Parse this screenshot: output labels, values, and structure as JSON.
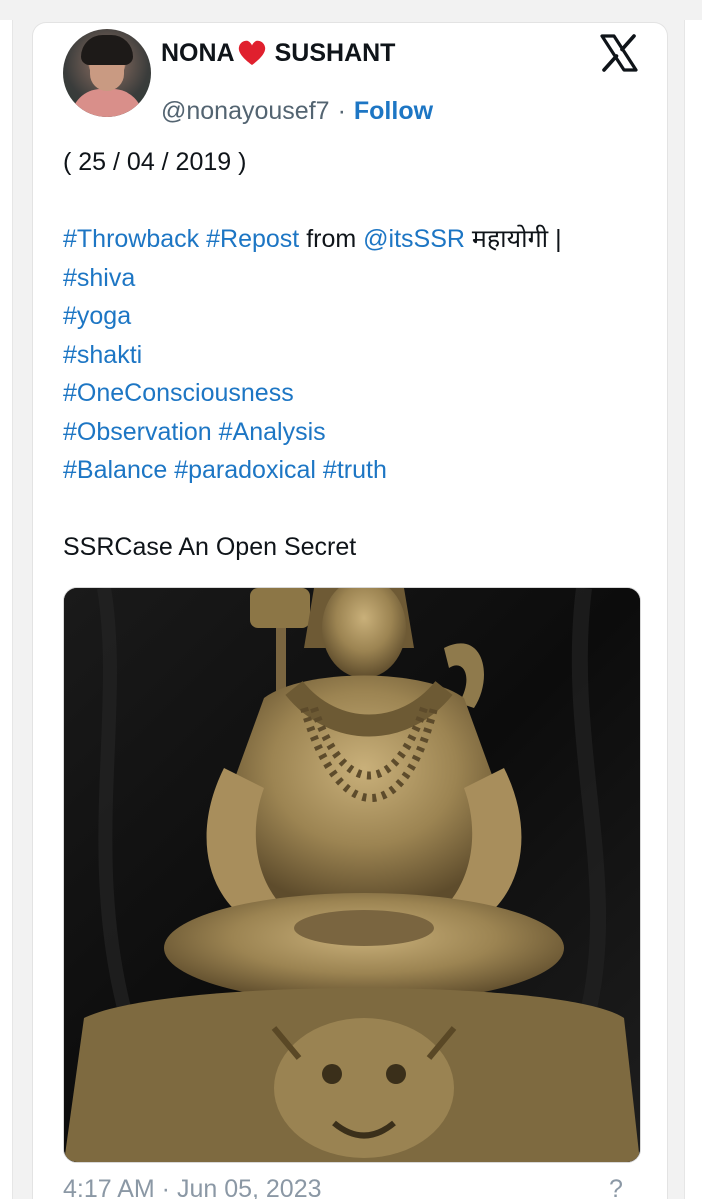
{
  "tweet": {
    "author_name_part1": "NONA",
    "author_name_part2": "SUSHANT",
    "handle": "@nonayousef7",
    "separator": "·",
    "follow_label": "Follow",
    "date_line": "( 25 / 04 / 2019 )",
    "line1": {
      "tag1": "#Throwback",
      "tag2": "#Repost",
      "word": "from",
      "mention": "@itsSSR",
      "hindi": "महायोगी |"
    },
    "tags": [
      "#shiva",
      "#yoga",
      "#shakti",
      "#OneConsciousness"
    ],
    "line_observation": [
      "#Observation",
      "#Analysis"
    ],
    "line_balance": [
      "#Balance",
      "#paradoxical",
      "#truth"
    ],
    "closing_text": "SSRCase An Open Secret",
    "footer_partial": "4:17 AM · Jun 05, 2023",
    "footer_right_partial": "?"
  },
  "icons": {
    "heart": "red-heart-emoji",
    "platform_logo": "x-logo-icon"
  },
  "colors": {
    "link": "#1d76c4",
    "heart": "#e0202e",
    "text": "#0f1419",
    "secondary": "#536471"
  }
}
